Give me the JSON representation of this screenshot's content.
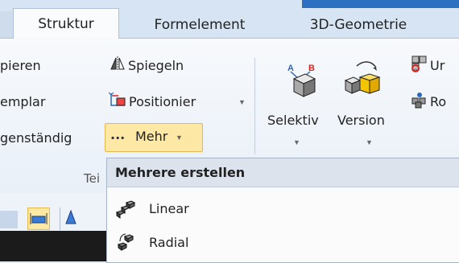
{
  "tabs": {
    "struktur": "Struktur",
    "formelement": "Formelement",
    "geometrie": "3D-Geometrie"
  },
  "left_column": {
    "item1": "pieren",
    "item2": "emplar",
    "item3": "genständig"
  },
  "middle_column": {
    "spiegeln": "Spiegeln",
    "positionier": "Positionier",
    "mehr": "Mehr",
    "mehr_prefix": "..."
  },
  "large_buttons": {
    "selektiv": "Selektiv",
    "version": "Version"
  },
  "right_column": {
    "item1": "Ur",
    "item2": "Ro"
  },
  "group_label": "Tei",
  "menu": {
    "header": "Mehrere erstellen",
    "items": [
      {
        "label": "Linear",
        "icon": "linear-pattern-icon"
      },
      {
        "label": "Radial",
        "icon": "radial-pattern-icon"
      }
    ]
  },
  "colors": {
    "accent": "#2d6fc0",
    "highlight": "#fde9a5",
    "highlight_border": "#e5b94d"
  }
}
